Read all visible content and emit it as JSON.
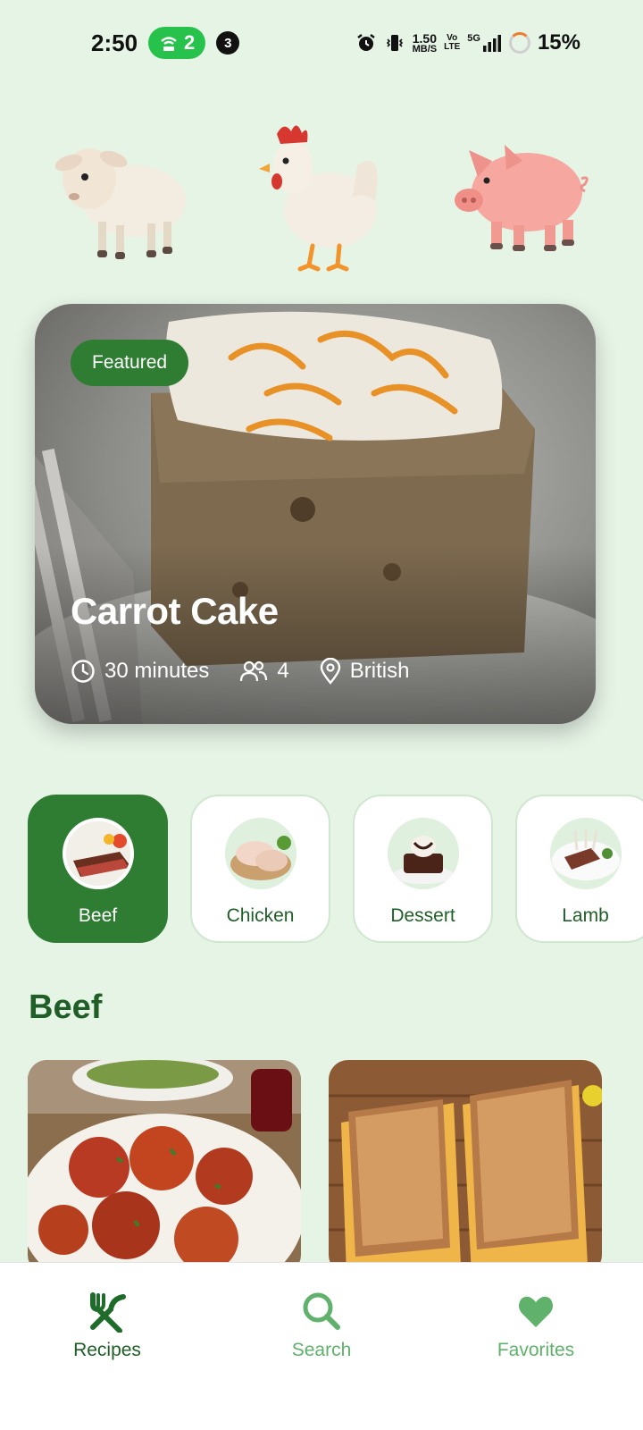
{
  "status_bar": {
    "time": "2:50",
    "hotspot_count": "2",
    "notification_count": "3",
    "speed_value": "1.50",
    "speed_unit": "MB/S",
    "volte_top": "Vo",
    "volte_bottom": "LTE",
    "network": "5G",
    "battery": "15%"
  },
  "animals": [
    {
      "name": "sheep-icon"
    },
    {
      "name": "chicken-icon"
    },
    {
      "name": "pig-icon"
    }
  ],
  "featured": {
    "badge": "Featured",
    "title": "Carrot Cake",
    "time": "30 minutes",
    "servings": "4",
    "cuisine": "British"
  },
  "categories": [
    {
      "label": "Beef",
      "active": true
    },
    {
      "label": "Chicken",
      "active": false
    },
    {
      "label": "Dessert",
      "active": false
    },
    {
      "label": "Lamb",
      "active": false
    }
  ],
  "section": {
    "title": "Beef"
  },
  "bottom_nav": {
    "items": [
      {
        "label": "Recipes",
        "icon": "fork-knife-icon",
        "active": true
      },
      {
        "label": "Search",
        "icon": "search-icon",
        "active": false
      },
      {
        "label": "Favorites",
        "icon": "heart-icon",
        "active": false
      }
    ]
  },
  "colors": {
    "background": "#e6f4e6",
    "primary": "#2e7d32",
    "primary_text": "#1f5f27",
    "inactive_nav": "#5fb16b"
  }
}
